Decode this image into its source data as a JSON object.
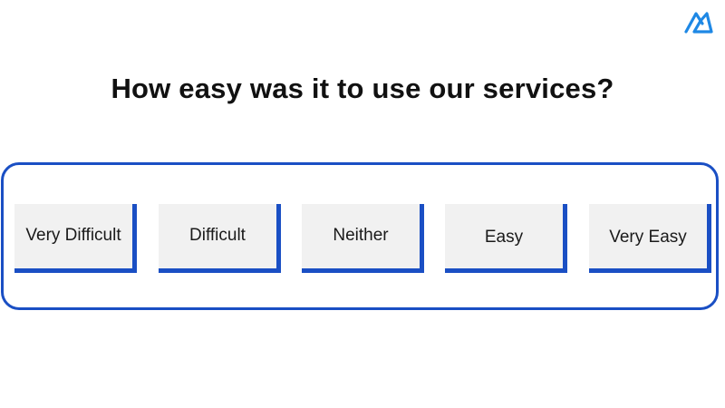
{
  "logo": {
    "icon": "brand-logo-icon",
    "color": "#1e88e5"
  },
  "question": "How easy was it to use our services?",
  "accent_color": "#1a4fc4",
  "options": [
    {
      "label": "Very Difficult"
    },
    {
      "label": "Difficult"
    },
    {
      "label": "Neither"
    },
    {
      "label": "Easy"
    },
    {
      "label": "Very Easy"
    }
  ]
}
